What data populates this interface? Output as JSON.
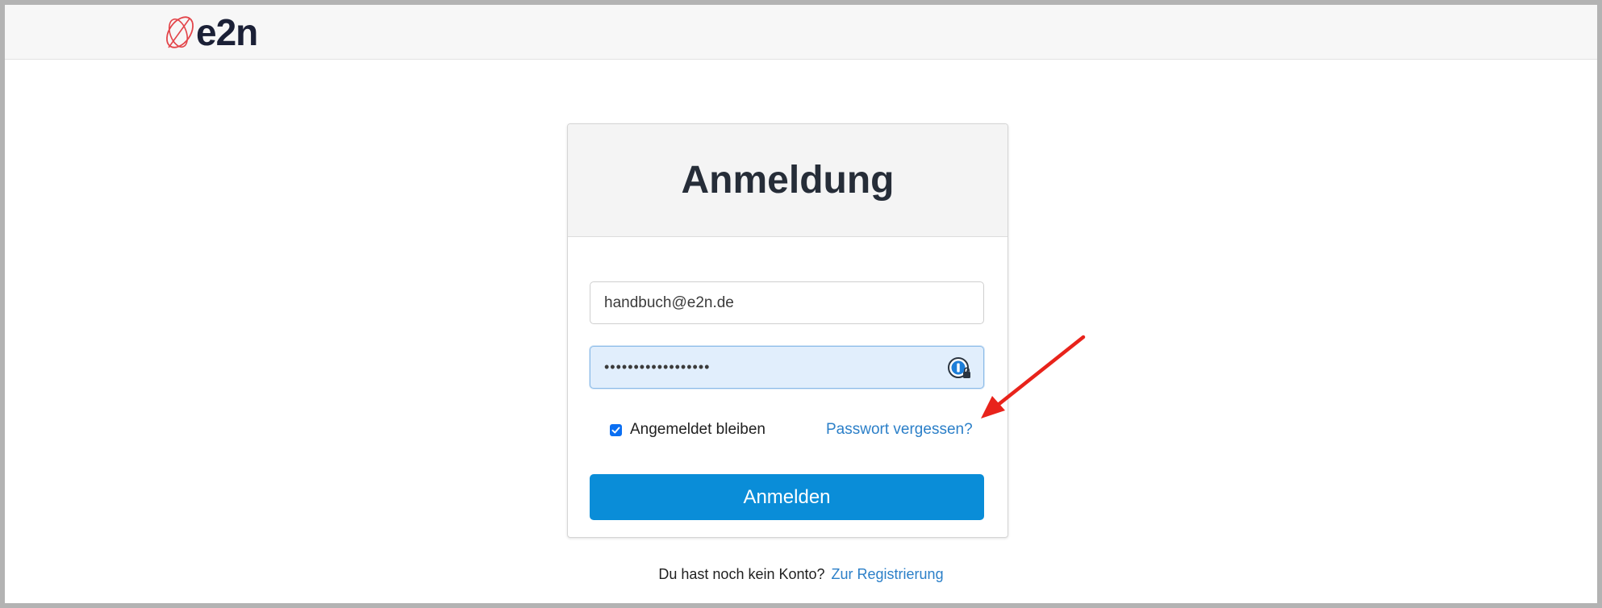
{
  "header": {
    "brand": "e2n"
  },
  "login": {
    "title": "Anmeldung",
    "email_value": "handbuch@e2n.de",
    "password_mask": "••••••••••••••••••",
    "remember_label": "Angemeldet bleiben",
    "remember_checked": true,
    "forgot_link": "Passwort vergessen?",
    "submit_label": "Anmelden"
  },
  "footer": {
    "no_account_text": "Du hast noch kein Konto?",
    "register_link": "Zur Registrierung"
  },
  "icons": {
    "logo": "e2n-logo-icon",
    "password_manager": "password-manager-icon",
    "check": "check-icon",
    "annotation": "red-arrow-annotation"
  },
  "colors": {
    "accent": "#0a8dd8",
    "link": "#2b7fc8",
    "brand_mark": "#e3454a",
    "brand_text": "#1b2036",
    "annotation": "#e8231b"
  }
}
